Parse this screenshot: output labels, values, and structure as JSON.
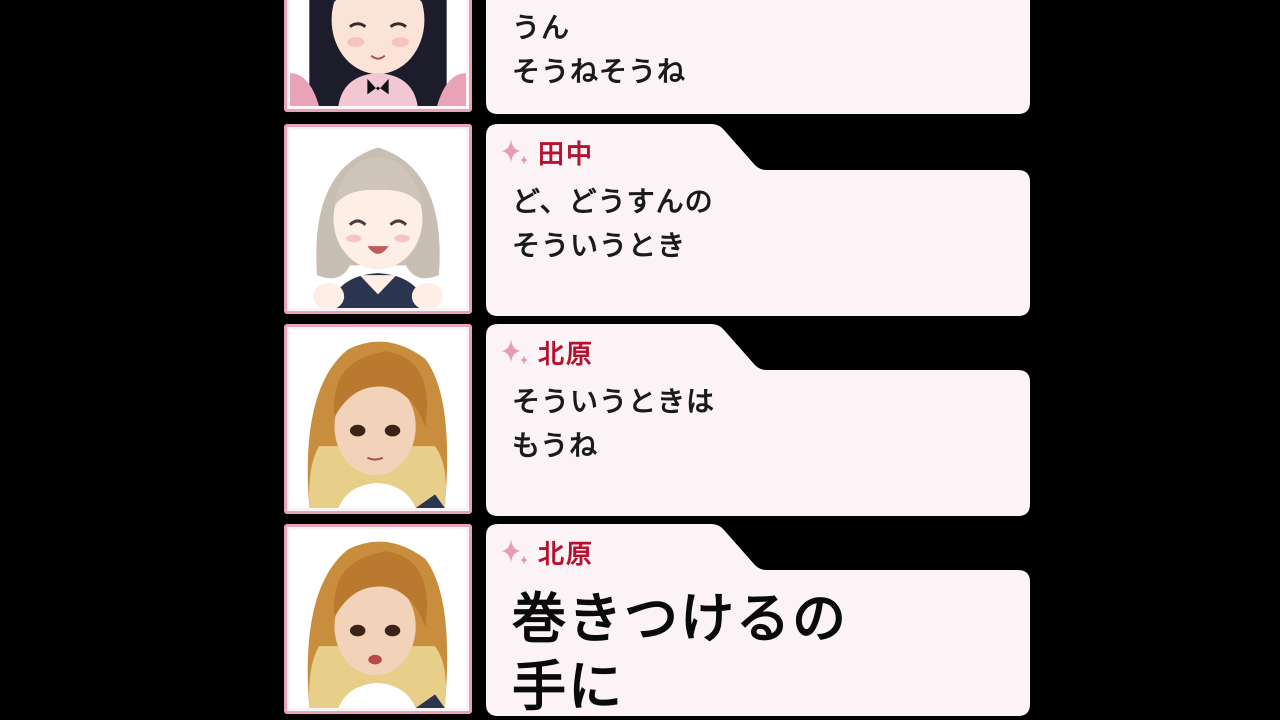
{
  "colors": {
    "background": "#000000",
    "portrait_border": "#e9a3b8",
    "bubble_fill": "#fbf3f5",
    "speaker_name": "#b5122f",
    "sparkle": "#e79ab4"
  },
  "dialogue": [
    {
      "speaker": "",
      "lines": [
        "うん",
        "そうねそうね"
      ],
      "emphasis": false,
      "character": "black-haired-girl"
    },
    {
      "speaker": "田中",
      "lines": [
        "ど、どうすんの",
        "そういうとき"
      ],
      "emphasis": false,
      "character": "light-haired-girl"
    },
    {
      "speaker": "北原",
      "lines": [
        "そういうときは",
        "もうね"
      ],
      "emphasis": false,
      "character": "blonde-girl"
    },
    {
      "speaker": "北原",
      "lines": [
        "巻きつけるの",
        "手に"
      ],
      "emphasis": true,
      "character": "blonde-girl"
    }
  ]
}
